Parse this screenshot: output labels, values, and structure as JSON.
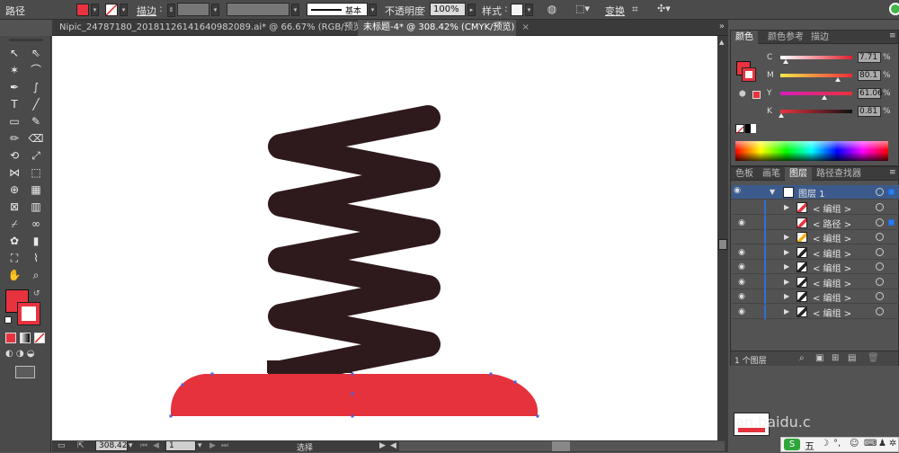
{
  "control_bar": {
    "selection_label": "路径",
    "stroke_label": "描边",
    "stroke_weight": "",
    "brush_label": "基本",
    "opacity_label": "不透明度",
    "opacity_value": "100%",
    "style_label": "样式",
    "transform_label": "变换",
    "fill_color": "#e8333f"
  },
  "tabs": [
    {
      "label": "Nipic_24787180_20181126141640982089.ai* @ 66.67% (RGB/预览)",
      "close": "×"
    },
    {
      "label": "未标题-4* @ 308.42% (CMYK/预览)",
      "close": "×"
    }
  ],
  "toolbar": {
    "tools": [
      "selection-tool",
      "direct-selection-tool",
      "magic-wand-tool",
      "lasso-tool",
      "pen-tool",
      "curvature-tool",
      "type-tool",
      "line-segment-tool",
      "rectangle-tool",
      "paintbrush-tool",
      "pencil-tool",
      "eraser-tool",
      "rotate-tool",
      "scale-tool",
      "width-tool",
      "free-transform-tool",
      "shape-builder-tool",
      "perspective-grid-tool",
      "mesh-tool",
      "gradient-tool",
      "eyedropper-tool",
      "blend-tool",
      "symbol-sprayer-tool",
      "column-graph-tool",
      "artboard-tool",
      "slice-tool",
      "hand-tool",
      "zoom-tool"
    ],
    "fill_color": "#e8333f",
    "stroke_color": "#ffffff"
  },
  "canvas": {
    "spring_color": "#2e1a1c",
    "base_color": "#e5323d",
    "anchor_color": "#4a62d8"
  },
  "status_bar": {
    "zoom": "308.42",
    "page": "1",
    "tool_name": "选择"
  },
  "color_panel": {
    "tabs": [
      "颜色",
      "颜色参考",
      "描边"
    ],
    "channels": [
      {
        "name": "C",
        "value": "7.71",
        "unit": "%",
        "gradient": "linear-gradient(90deg,#ffffff,#e02030)",
        "level": 0.0771
      },
      {
        "name": "M",
        "value": "80.1",
        "unit": "%",
        "gradient": "linear-gradient(90deg,#f2e94a,#ef2b3a)",
        "level": 0.801
      },
      {
        "name": "Y",
        "value": "61.06",
        "unit": "%",
        "gradient": "linear-gradient(90deg,#d81dbd,#e9313b)",
        "level": 0.6106
      },
      {
        "name": "K",
        "value": "0.81",
        "unit": "%",
        "gradient": "linear-gradient(90deg,#e8333f,#111111)",
        "level": 0.0081
      }
    ]
  },
  "layers_panel": {
    "tabs": [
      "色板",
      "画笔",
      "图层",
      "路径查找器"
    ],
    "layer_name": "图层 1",
    "rows": [
      {
        "name": "< 编组 >",
        "eye": "",
        "thumb": "#e8333f",
        "expand": "▶"
      },
      {
        "name": "< 路径 >",
        "eye": "◉",
        "thumb": "#e8333f",
        "expand": ""
      },
      {
        "name": "< 编组 >",
        "eye": "",
        "thumb": "#f2b318",
        "expand": "▶"
      },
      {
        "name": "< 编组 >",
        "eye": "◉",
        "thumb": "#222222",
        "expand": "▶"
      },
      {
        "name": "< 编组 >",
        "eye": "◉",
        "thumb": "#222222",
        "expand": "▶"
      },
      {
        "name": "< 编组 >",
        "eye": "◉",
        "thumb": "#222222",
        "expand": "▶"
      },
      {
        "name": "< 编组 >",
        "eye": "◉",
        "thumb": "#222222",
        "expand": "▶"
      },
      {
        "name": "< 编组 >",
        "eye": "◉",
        "thumb": "#222222",
        "expand": "▶"
      }
    ],
    "footer": "1 个图层"
  },
  "watermark": "an.baidu.c",
  "ime": {
    "label": "五"
  }
}
